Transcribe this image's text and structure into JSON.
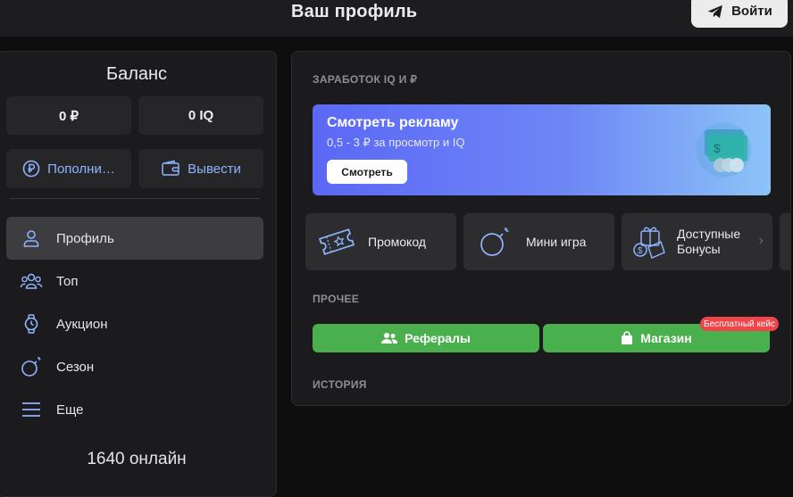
{
  "header": {
    "title": "Ваш профиль",
    "login_label": "Войти"
  },
  "sidebar": {
    "balance_title": "Баланс",
    "balance_rub": "0 ₽",
    "balance_iq": "0 IQ",
    "deposit_label": "Пополни…",
    "withdraw_label": "Вывести",
    "nav": [
      {
        "label": "Профиль",
        "icon": "user-icon",
        "active": true
      },
      {
        "label": "Топ",
        "icon": "users-icon"
      },
      {
        "label": "Аукцион",
        "icon": "watch-icon"
      },
      {
        "label": "Сезон",
        "icon": "bomb-icon"
      },
      {
        "label": "Еще",
        "icon": "menu-icon"
      }
    ],
    "online_text": "1640 онлайн"
  },
  "main": {
    "earn_heading": "ЗАРАБОТОК IQ И ₽",
    "ad": {
      "title": "Смотреть рекламу",
      "subtitle": "0,5 - 3 ₽ за просмотр и IQ",
      "button_label": "Смотреть"
    },
    "tiles": [
      {
        "label": "Промокод",
        "icon": "ticket-icon"
      },
      {
        "label": "Мини игра",
        "icon": "bomb-icon"
      },
      {
        "label": "Доступные Бонусы",
        "icon": "bonus-icon"
      }
    ],
    "other_heading": "ПРОЧЕЕ",
    "referrals_label": "Рефералы",
    "shop_label": "Магазин",
    "shop_badge": "Бесплатный кейс",
    "history_heading": "ИСТОРИЯ"
  },
  "colors": {
    "accent_blue": "#8fb4ff",
    "green": "#4aaf4d",
    "badge_red": "#f0444b",
    "banner_start": "#5b68f5",
    "banner_end": "#8cc4f7"
  }
}
